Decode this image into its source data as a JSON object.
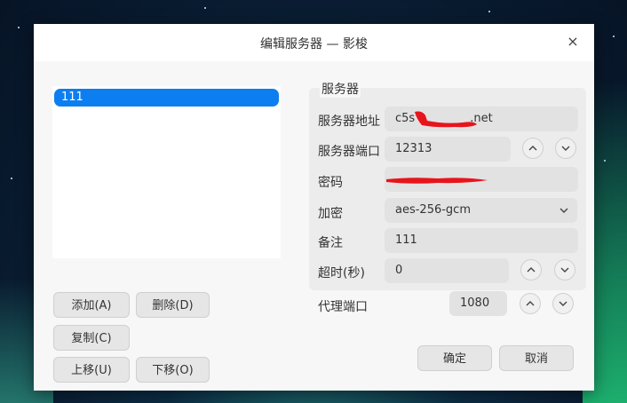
{
  "window": {
    "title": "编辑服务器 — 影梭",
    "close_label": "×"
  },
  "server_list": {
    "items": [
      {
        "label": "111",
        "selected": true
      }
    ]
  },
  "list_buttons": {
    "add": "添加(A)",
    "delete": "删除(D)",
    "copy": "复制(C)",
    "move_up": "上移(U)",
    "move_down": "下移(O)"
  },
  "server_group": {
    "title": "服务器",
    "address_label": "服务器地址",
    "address_value_visible_prefix": "c5s",
    "address_value_visible_suffix": ".net",
    "port_label": "服务器端口",
    "port_value": "12313",
    "password_label": "密码",
    "encryption_label": "加密",
    "encryption_value": "aes-256-gcm",
    "remark_label": "备注",
    "remark_value": "111",
    "timeout_label": "超时(秒)",
    "timeout_value": "0"
  },
  "proxy": {
    "label": "代理端口",
    "value": "1080"
  },
  "footer": {
    "ok": "确定",
    "cancel": "取消"
  },
  "icons": {
    "up": "chevron-up-icon",
    "down": "chevron-down-icon",
    "dropdown": "chevron-down-icon",
    "close": "close-icon"
  },
  "colors": {
    "selection": "#0d7ef0",
    "redaction": "#e8141c"
  }
}
